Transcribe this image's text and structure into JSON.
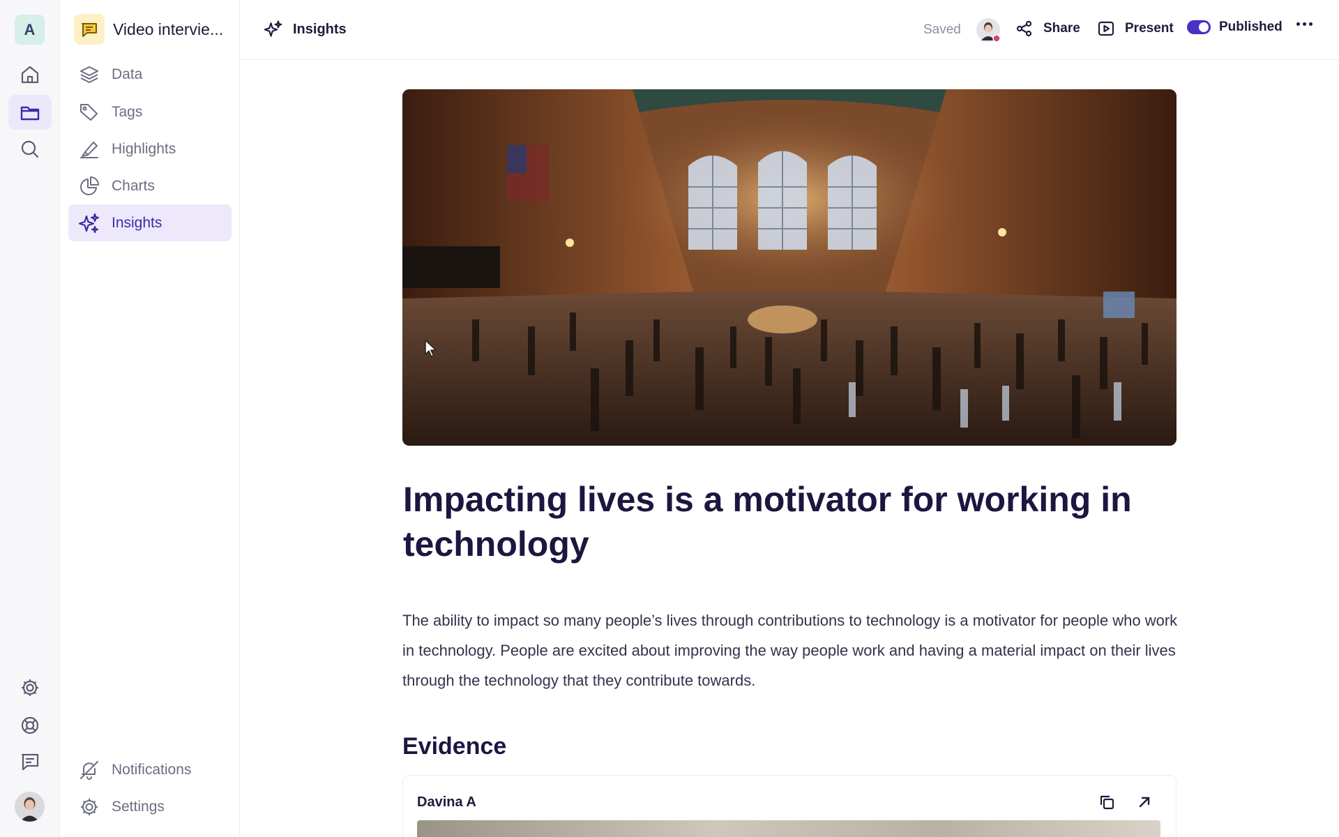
{
  "rail": {
    "workspace_initial": "A",
    "items": [
      {
        "name": "home-icon"
      },
      {
        "name": "folder-icon",
        "active": true
      },
      {
        "name": "search-icon"
      },
      {
        "name": "settings-icon"
      },
      {
        "name": "help-icon"
      },
      {
        "name": "feedback-icon"
      }
    ]
  },
  "sidebar": {
    "project_title": "Video intervie...",
    "items": [
      {
        "label": "Data",
        "icon": "layers-icon"
      },
      {
        "label": "Tags",
        "icon": "tag-icon"
      },
      {
        "label": "Highlights",
        "icon": "highlighter-icon"
      },
      {
        "label": "Charts",
        "icon": "pie-chart-icon"
      },
      {
        "label": "Insights",
        "icon": "sparkles-icon",
        "active": true
      }
    ],
    "footer": [
      {
        "label": "Notifications",
        "icon": "bell-off-icon"
      },
      {
        "label": "Settings",
        "icon": "gear-icon"
      }
    ]
  },
  "topbar": {
    "breadcrumb": "Insights",
    "saved_label": "Saved",
    "share_label": "Share",
    "present_label": "Present",
    "published_label": "Published",
    "published": true
  },
  "insight": {
    "title": "Impacting lives is a motivator for working in technology",
    "body": "The ability to impact so many people’s lives through contributions to technology is a motivator for people who work in technology. People are excited about improving the way people work and having a material impact on their lives through the technology that they contribute towards.",
    "evidence_heading": "Evidence",
    "evidence": [
      {
        "name": "Davina A"
      }
    ]
  },
  "colors": {
    "accent": "#4b2fc9",
    "active_nav_bg": "#ede9fb",
    "heading": "#1c1640"
  }
}
